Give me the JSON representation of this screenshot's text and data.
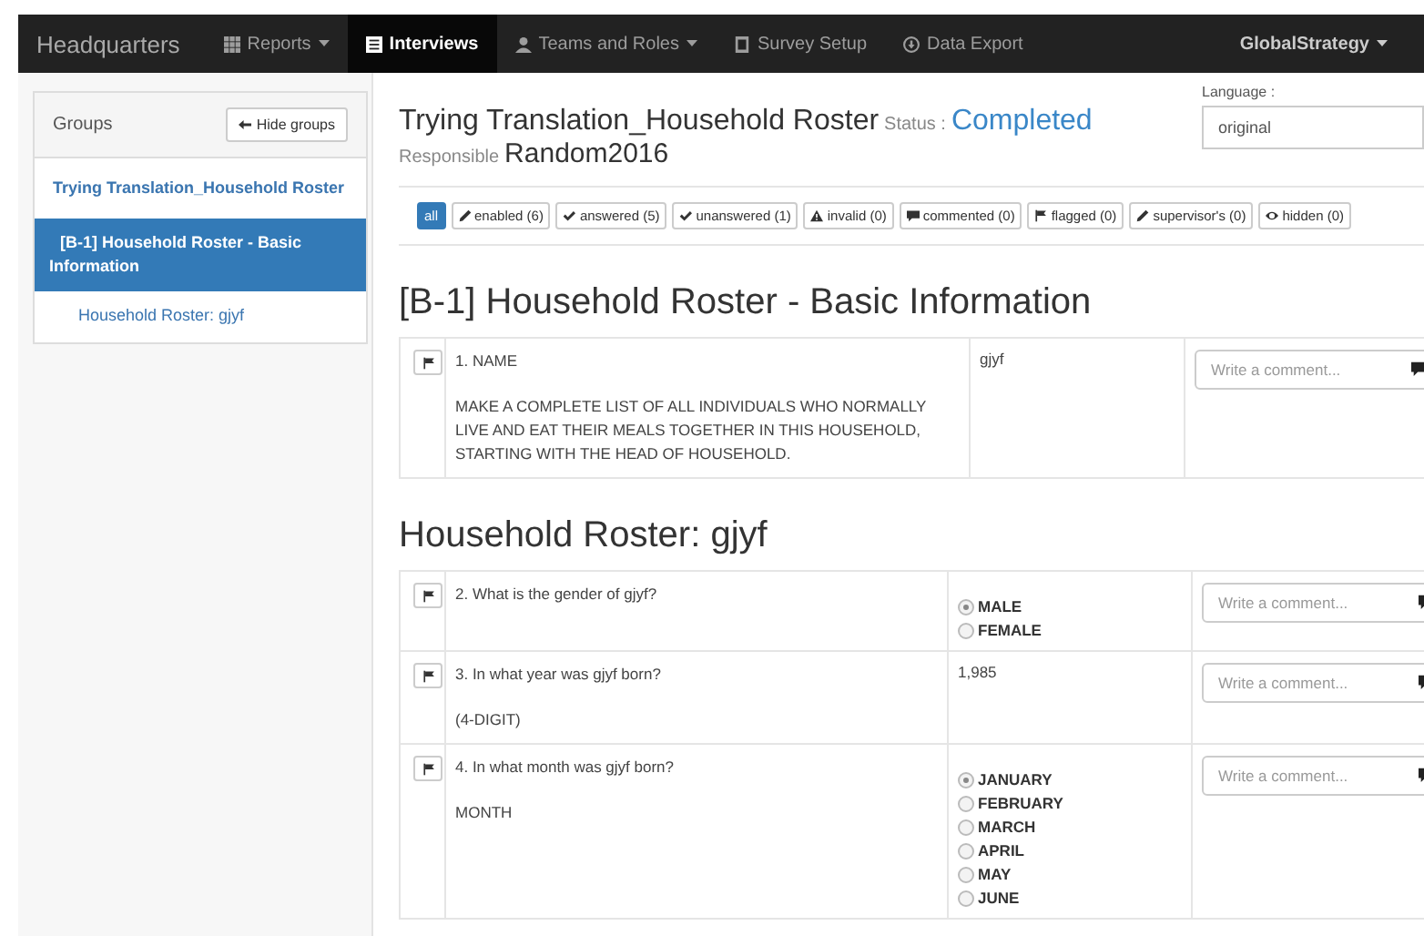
{
  "navbar": {
    "brand": "Headquarters",
    "items": [
      {
        "label": "Reports",
        "kind": "grid",
        "dropdown": true,
        "selected": false
      },
      {
        "label": "Interviews",
        "kind": "list",
        "dropdown": false,
        "selected": true
      },
      {
        "label": "Teams and Roles",
        "kind": "user",
        "dropdown": true,
        "selected": false
      },
      {
        "label": "Survey Setup",
        "kind": "doc",
        "dropdown": false,
        "selected": false
      },
      {
        "label": "Data Export",
        "kind": "download",
        "dropdown": false,
        "selected": false
      }
    ],
    "user": "GlobalStrategy"
  },
  "sidebar": {
    "title": "Groups",
    "hide_button": "Hide groups",
    "items": [
      {
        "label": "Trying Translation_Household Roster",
        "selected": false,
        "children": [
          {
            "label": "[B-1] Household Roster - Basic Information",
            "selected": true,
            "children": [
              {
                "label": "Household Roster: gjyf",
                "selected": false
              }
            ]
          }
        ]
      }
    ]
  },
  "header": {
    "title": "Trying Translation_Household Roster",
    "status_label": "Status :",
    "status": "Completed",
    "responsible_label": "Responsible",
    "responsible": "Random2016"
  },
  "language": {
    "label": "Language :",
    "value": "original"
  },
  "filters": [
    {
      "label": "all",
      "kind": "plain",
      "selected": true
    },
    {
      "label": "enabled (6)",
      "kind": "pencil",
      "selected": false
    },
    {
      "label": "answered (5)",
      "kind": "check",
      "selected": false
    },
    {
      "label": "unanswered (1)",
      "kind": "check",
      "selected": false
    },
    {
      "label": "invalid (0)",
      "kind": "warning",
      "selected": false
    },
    {
      "label": "commented (0)",
      "kind": "comment",
      "selected": false
    },
    {
      "label": "flagged (0)",
      "kind": "flag",
      "selected": false
    },
    {
      "label": "supervisor's (0)",
      "kind": "pencil",
      "selected": false
    },
    {
      "label": "hidden (0)",
      "kind": "eye",
      "selected": false
    }
  ],
  "sections": [
    {
      "title": "[B-1] Household Roster - Basic Information",
      "questions": [
        {
          "text": "1. NAME",
          "instruction": "MAKE A COMPLETE LIST OF ALL INDIVIDUALS WHO NORMALLY LIVE AND EAT THEIR MEALS TOGETHER IN THIS HOUSEHOLD, STARTING WITH THE HEAD OF HOUSEHOLD.",
          "kind": "text",
          "answer": "gjyf",
          "comment_placeholder": "Write a comment..."
        }
      ]
    },
    {
      "title": "Household Roster: gjyf",
      "questions": [
        {
          "text": "2. What is the gender of gjyf?",
          "kind": "radio",
          "options": [
            {
              "label": "MALE",
              "selected": true
            },
            {
              "label": "FEMALE",
              "selected": false
            }
          ],
          "comment_placeholder": "Write a comment..."
        },
        {
          "text": "3. In what year was gjyf born?",
          "instruction": "(4-DIGIT)",
          "kind": "text",
          "answer": "1,985",
          "comment_placeholder": "Write a comment..."
        },
        {
          "text": "4. In what month was gjyf born?",
          "instruction": "MONTH",
          "kind": "radio",
          "options": [
            {
              "label": "JANUARY",
              "selected": true
            },
            {
              "label": "FEBRUARY",
              "selected": false
            },
            {
              "label": "MARCH",
              "selected": false
            },
            {
              "label": "APRIL",
              "selected": false
            },
            {
              "label": "MAY",
              "selected": false
            },
            {
              "label": "JUNE",
              "selected": false
            }
          ],
          "comment_placeholder": "Write a comment..."
        }
      ]
    }
  ]
}
